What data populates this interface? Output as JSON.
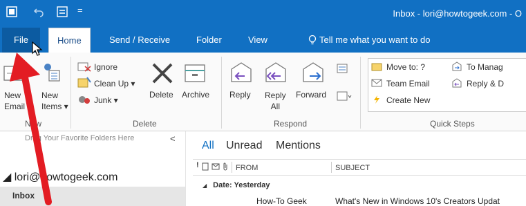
{
  "titlebar": {
    "title": "Inbox - lori@howtogeek.com - O"
  },
  "tabs": {
    "file": "File",
    "home": "Home",
    "send_receive": "Send / Receive",
    "folder": "Folder",
    "view": "View",
    "tell": "Tell me what you want to do"
  },
  "ribbon": {
    "new_email": [
      "New",
      "Email"
    ],
    "new_items": [
      "New",
      "Items ▾"
    ],
    "new_group": "New",
    "ignore": "Ignore",
    "clean_up": "Clean Up ▾",
    "junk": "Junk ▾",
    "delete": "Delete",
    "archive": "Archive",
    "delete_group": "Delete",
    "reply": "Reply",
    "reply_all": [
      "Reply",
      "All"
    ],
    "forward": "Forward",
    "respond_group": "Respond",
    "quick_steps": [
      "Move to: ?",
      "Team Email",
      "Create New",
      "To Manag",
      "Reply & D"
    ],
    "quick_steps_group": "Quick Steps"
  },
  "sidebar": {
    "drag_hint": "Drag Your Favorite Folders Here",
    "collapse": "<",
    "account": "◢ lori@howtogeek.com",
    "inbox": "Inbox"
  },
  "mail": {
    "filters": [
      "All",
      "Unread",
      "Mentions"
    ],
    "col_from": "FROM",
    "col_subject": "SUBJECT",
    "date_group": "Date: Yesterday",
    "row_from": "How-To Geek",
    "row_subject": "What's New in Windows 10's Creators Updat"
  },
  "colors": {
    "accent": "#1170c3",
    "annotation_arrow": "#e31c23"
  }
}
